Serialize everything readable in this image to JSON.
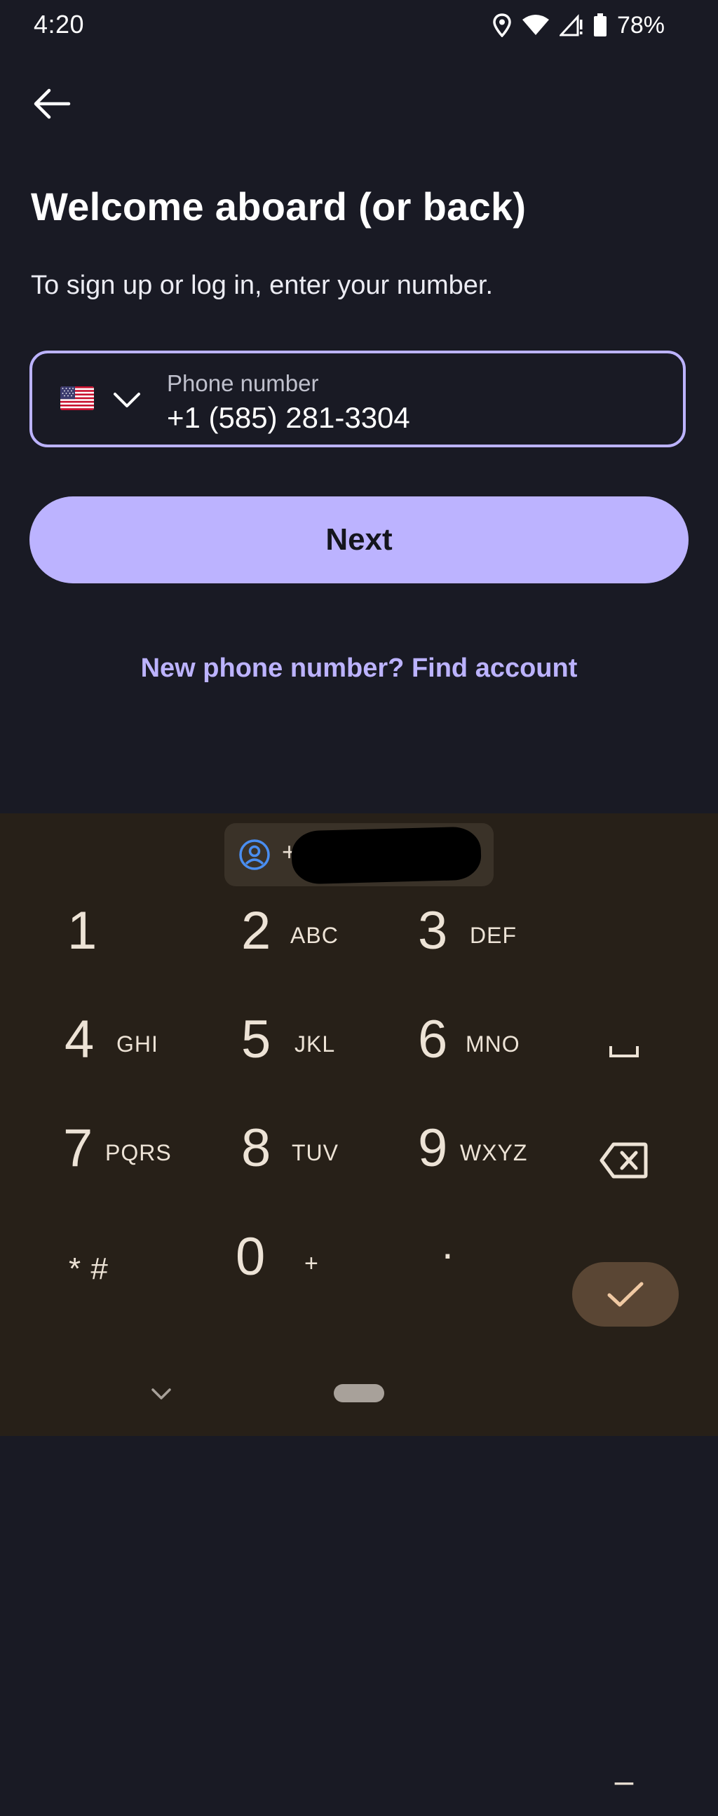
{
  "status_bar": {
    "time": "4:20",
    "battery": "78%",
    "icons": [
      "location-icon",
      "wifi-icon",
      "cell-signal-icon",
      "battery-icon"
    ]
  },
  "header": {
    "back_icon": "arrow-left-icon",
    "title": "Welcome aboard (or back)",
    "subtitle": "To sign up or log in, enter your number."
  },
  "phone_field": {
    "country_flag": "us-flag-icon",
    "label": "Phone number",
    "value": "+1 (585) 281-3304"
  },
  "next_button": {
    "label": "Next"
  },
  "find_account_link": {
    "label": "New phone number? Find account"
  },
  "keyboard": {
    "suggestion_prefix": "+",
    "keys": [
      {
        "digit": "1",
        "letters": ""
      },
      {
        "digit": "2",
        "letters": "ABC"
      },
      {
        "digit": "3",
        "letters": "DEF"
      },
      {
        "digit": "4",
        "letters": "GHI"
      },
      {
        "digit": "5",
        "letters": "JKL"
      },
      {
        "digit": "6",
        "letters": "MNO"
      },
      {
        "digit": "7",
        "letters": "PQRS"
      },
      {
        "digit": "8",
        "letters": "TUV"
      },
      {
        "digit": "9",
        "letters": "WXYZ"
      },
      {
        "digit": "0",
        "letters": "+"
      }
    ],
    "symbols_key": "* #",
    "period_key": ".",
    "dash_key": "–"
  },
  "colors": {
    "background": "#191a24",
    "accent": "#bcb3ff",
    "keyboard_bg": "#272018",
    "done_key": "#5a4634"
  }
}
